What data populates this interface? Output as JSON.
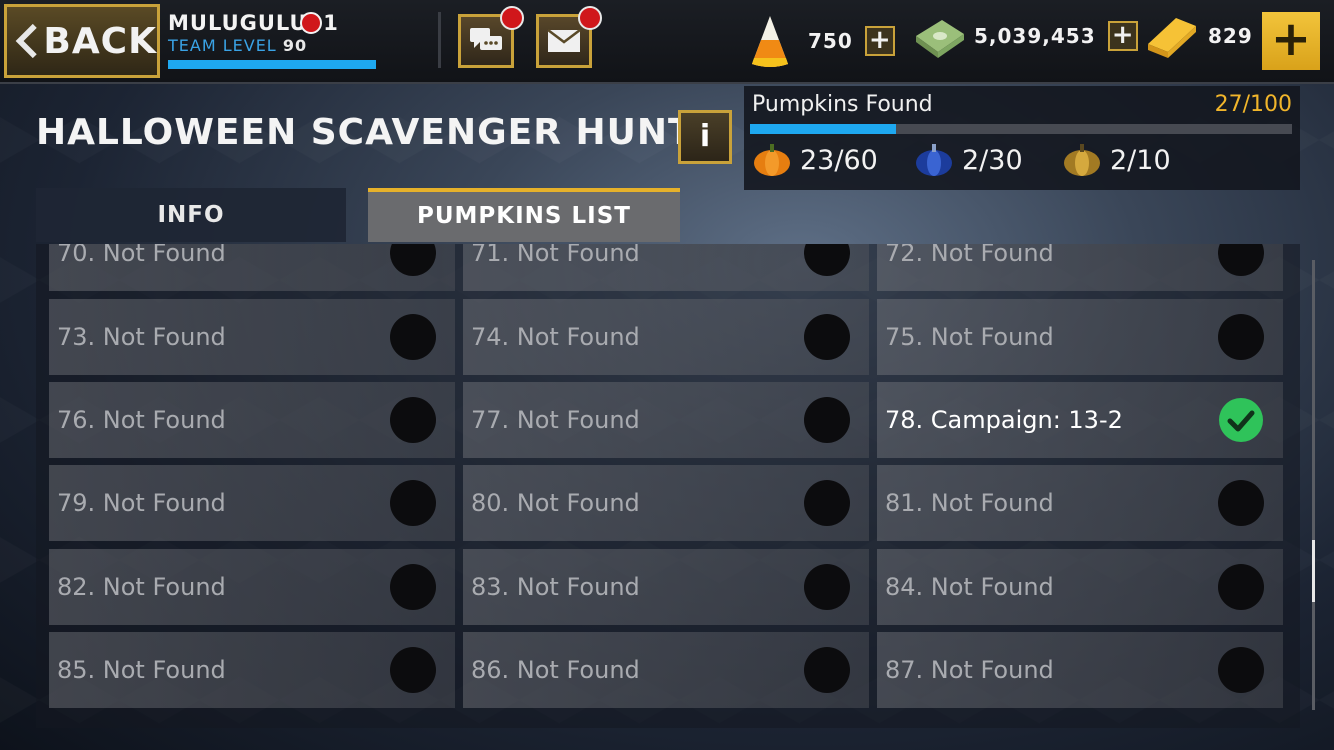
{
  "header": {
    "back_label": "BACK",
    "player_name": "MULUGULU91",
    "team_level_label": "TEAM LEVEL",
    "team_level_value": "90",
    "chat_icon": "chat-icon",
    "mail_icon": "mail-icon"
  },
  "currencies": [
    {
      "name": "candy-corn",
      "amount": "750"
    },
    {
      "name": "cash",
      "amount": "5,039,453"
    },
    {
      "name": "gold",
      "amount": "829"
    }
  ],
  "title": "HALLOWEEN SCAVENGER HUNT",
  "info_button": "i",
  "progress": {
    "label": "Pumpkins Found",
    "count": "27/100",
    "fraction": 0.27,
    "orange": "23/60",
    "blue": "2/30",
    "gold": "2/10"
  },
  "tabs": {
    "info": "INFO",
    "pumpkins": "PUMPKINS LIST"
  },
  "partial_row": [
    "70. Not Found",
    "71. Not Found",
    "72. Not Found"
  ],
  "rows": [
    [
      "73. Not Found",
      "74. Not Found",
      "75. Not Found"
    ],
    [
      "76. Not Found",
      "77. Not Found",
      "78. Campaign: 13-2"
    ],
    [
      "79. Not Found",
      "80. Not Found",
      "81. Not Found"
    ],
    [
      "82. Not Found",
      "83. Not Found",
      "84. Not Found"
    ],
    [
      "85. Not Found",
      "86. Not Found",
      "87. Not Found"
    ]
  ],
  "colors": {
    "accent_gold": "#c9a23a",
    "progress_blue": "#1ea8f0",
    "count_gold": "#f1b52b",
    "found_check": "#2fc35a"
  }
}
